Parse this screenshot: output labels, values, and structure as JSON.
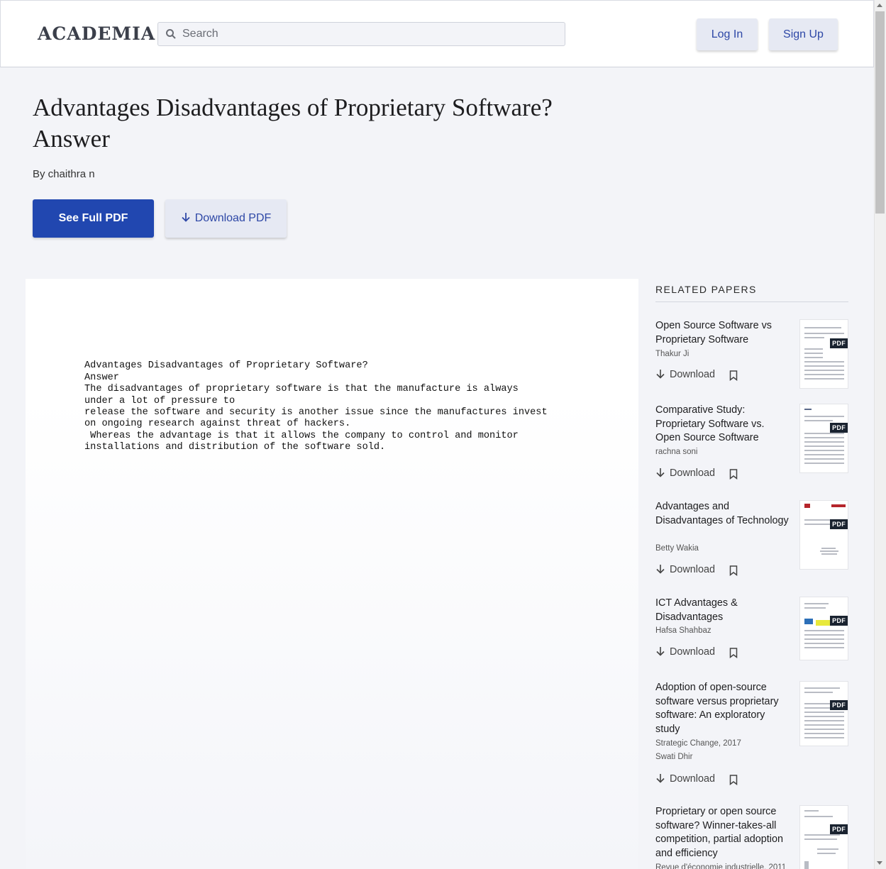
{
  "header": {
    "logo": "ACADEMIA",
    "search_placeholder": "Search",
    "login_label": "Log In",
    "signup_label": "Sign Up"
  },
  "paper": {
    "title": "Advantages Disadvantages of Proprietary Software? Answer",
    "author_line": "By chaithra n",
    "see_full_pdf_label": "See Full PDF",
    "download_pdf_label": "Download PDF",
    "body_lines": [
      "Advantages Disadvantages of Proprietary Software?",
      "Answer",
      "The disadvantages of proprietary software is that the manufacture is always",
      "under a lot of pressure to",
      "release the software and security is another issue since the manufactures invest",
      "on ongoing research against threat of hackers.",
      " Whereas the advantage is that it allows the company to control and monitor",
      "installations and distribution of the software sold."
    ]
  },
  "related": {
    "heading": "RELATED PAPERS",
    "download_label": "Download",
    "pdf_tag": "PDF",
    "items": [
      {
        "title": "Open Source Software vs Proprietary Software",
        "journal": "",
        "author": "Thakur Ji"
      },
      {
        "title": "Comparative Study: Proprietary Software vs. Open Source Software",
        "journal": "",
        "author": "rachna soni"
      },
      {
        "title": "Advantages and Disadvantages of Technology",
        "journal": "",
        "author": "Betty Wakia"
      },
      {
        "title": "ICT Advantages & Disadvantages",
        "journal": "",
        "author": "Hafsa Shahbaz"
      },
      {
        "title": "Adoption of open-source software versus proprietary software: An exploratory study",
        "journal": "Strategic Change, 2017",
        "author": "Swati Dhir"
      },
      {
        "title": "Proprietary or open source software? Winner-takes-all competition, partial adoption and efficiency",
        "journal": "Revue d'économie industrielle, 2011",
        "author": ""
      }
    ]
  },
  "colors": {
    "primary": "#2147b0",
    "secondary_bg": "#e6e9f3",
    "page_bg": "#f3f4f8"
  }
}
